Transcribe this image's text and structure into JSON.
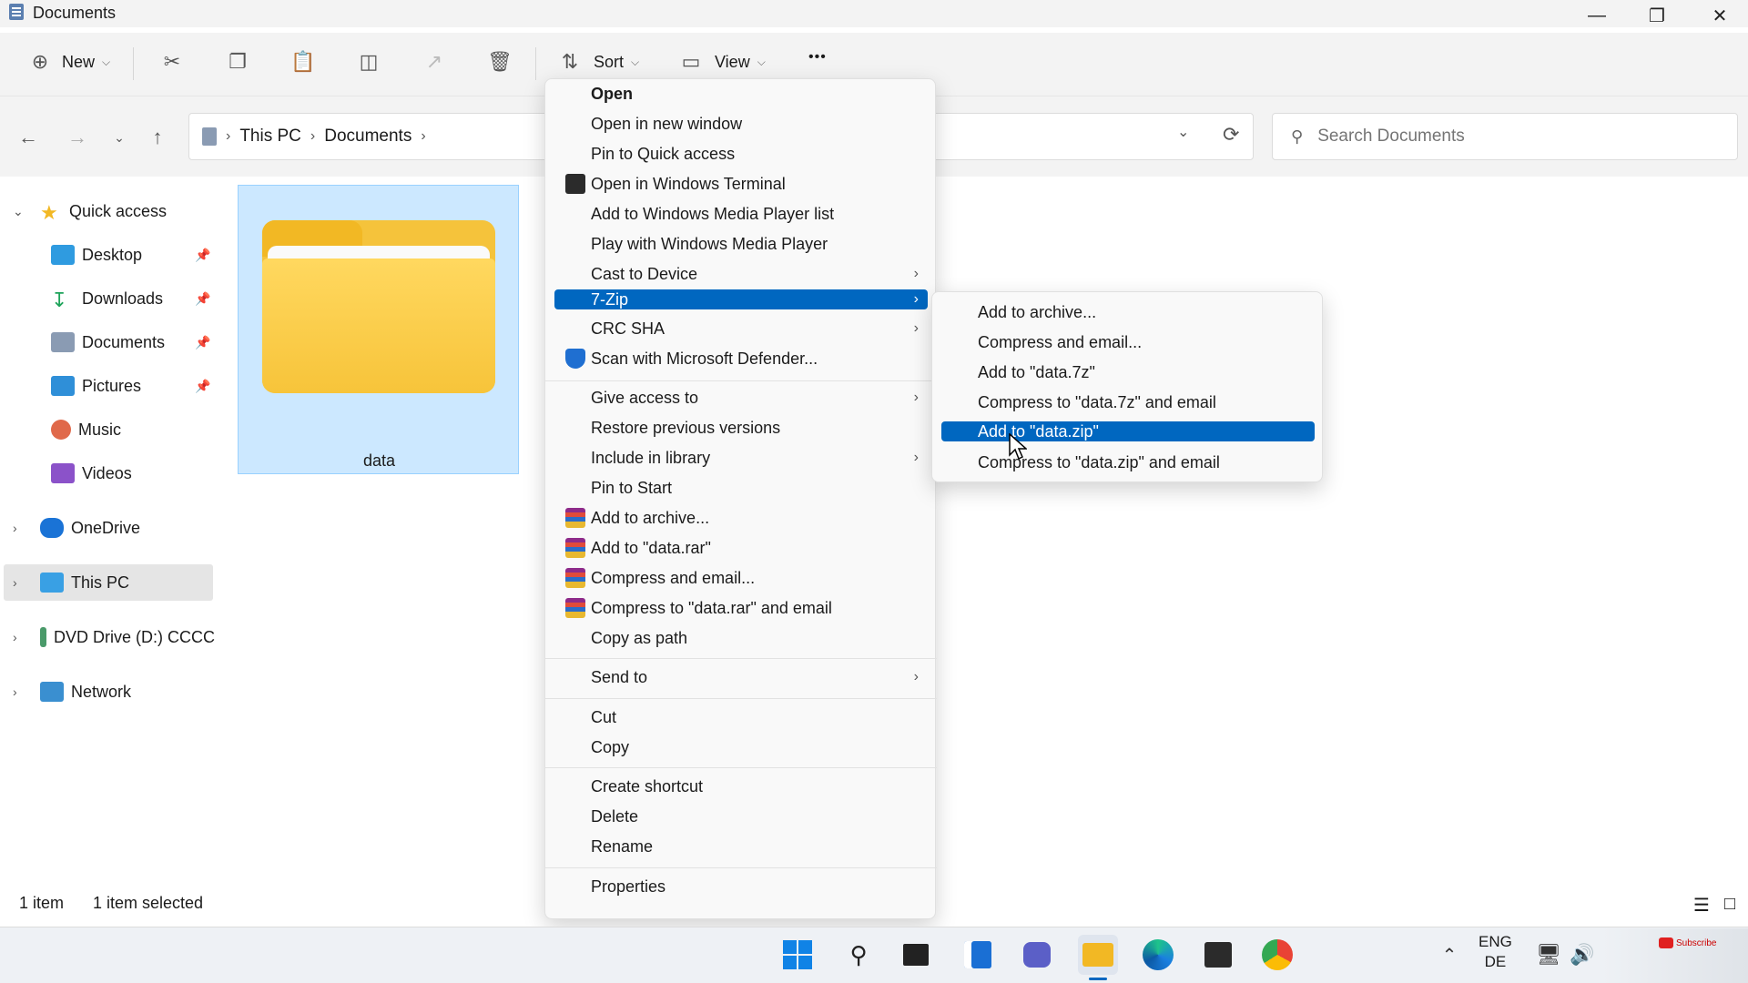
{
  "window": {
    "title": "Documents"
  },
  "toolbar": {
    "new_label": "New",
    "sort_label": "Sort",
    "view_label": "View",
    "more_label": "•••"
  },
  "address": {
    "crumbs": [
      "This PC",
      "Documents"
    ],
    "search_placeholder": "Search Documents"
  },
  "sidebar": {
    "quick_access": "Quick access",
    "items": [
      "Desktop",
      "Downloads",
      "Documents",
      "Pictures",
      "Music",
      "Videos"
    ],
    "onedrive": "OneDrive",
    "this_pc": "This PC",
    "dvd": "DVD Drive (D:) CCCC",
    "network": "Network"
  },
  "content": {
    "folder_name": "data"
  },
  "status": {
    "count": "1 item",
    "selected": "1 item selected"
  },
  "context_menu": {
    "items": [
      "Open",
      "Open in new window",
      "Pin to Quick access",
      "Open in Windows Terminal",
      "Add to Windows Media Player list",
      "Play with Windows Media Player",
      "Cast to Device",
      "7-Zip",
      "CRC SHA",
      "Scan with Microsoft Defender...",
      "Give access to",
      "Restore previous versions",
      "Include in library",
      "Pin to Start",
      "Add to archive...",
      "Add to \"data.rar\"",
      "Compress and email...",
      "Compress to \"data.rar\" and email",
      "Copy as path",
      "Send to",
      "Cut",
      "Copy",
      "Create shortcut",
      "Delete",
      "Rename",
      "Properties"
    ]
  },
  "submenu_7zip": {
    "items": [
      "Add to archive...",
      "Compress and email...",
      "Add to \"data.7z\"",
      "Compress to \"data.7z\" and email",
      "Add to \"data.zip\"",
      "Compress to \"data.zip\" and email"
    ]
  },
  "tray": {
    "lang1": "ENG",
    "lang2": "DE",
    "subscribe": "Subscribe"
  },
  "colors": {
    "accent": "#0067c0",
    "selection": "#cce8ff",
    "folder": "#f5c33b"
  }
}
